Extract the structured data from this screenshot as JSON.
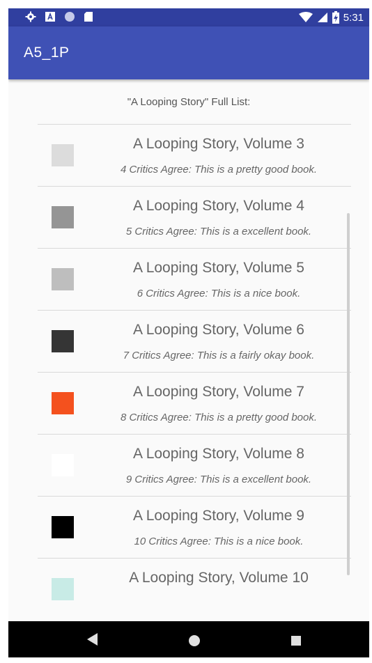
{
  "status_bar": {
    "time": "5:31",
    "icons_left": [
      "gear-icon",
      "a-notification-icon",
      "circle-icon",
      "sd-card-icon"
    ],
    "icons_right": [
      "wifi-icon",
      "signal-icon",
      "battery-charging-icon"
    ]
  },
  "app_bar": {
    "title": "A5_1P"
  },
  "list": {
    "header": "\"A Looping Story\" Full List:",
    "items": [
      {
        "title": "A Looping Story, Volume 3",
        "subtitle": "4 Critics Agree: This is a pretty good book.",
        "color": "#dcdcdc"
      },
      {
        "title": "A Looping Story, Volume 4",
        "subtitle": "5 Critics Agree: This is a excellent book.",
        "color": "#959595"
      },
      {
        "title": "A Looping Story, Volume 5",
        "subtitle": "6 Critics Agree: This is a nice book.",
        "color": "#bebebe"
      },
      {
        "title": "A Looping Story, Volume 6",
        "subtitle": "7 Critics Agree: This is a fairly okay book.",
        "color": "#353535"
      },
      {
        "title": "A Looping Story, Volume 7",
        "subtitle": "8 Critics Agree: This is a pretty good book.",
        "color": "#f4511e"
      },
      {
        "title": "A Looping Story, Volume 8",
        "subtitle": "9 Critics Agree: This is a excellent book.",
        "color": "#ffffff"
      },
      {
        "title": "A Looping Story, Volume 9",
        "subtitle": "10 Critics Agree: This is a nice book.",
        "color": "#000000"
      },
      {
        "title": "A Looping Story, Volume 10",
        "subtitle": "",
        "color": "#c8ebe6"
      }
    ]
  },
  "nav_bar": {
    "buttons": [
      "back-icon",
      "home-icon",
      "recents-icon"
    ]
  },
  "colors": {
    "status_bar": "#303f9f",
    "app_bar": "#3f51b5",
    "nav_bar": "#000000"
  }
}
